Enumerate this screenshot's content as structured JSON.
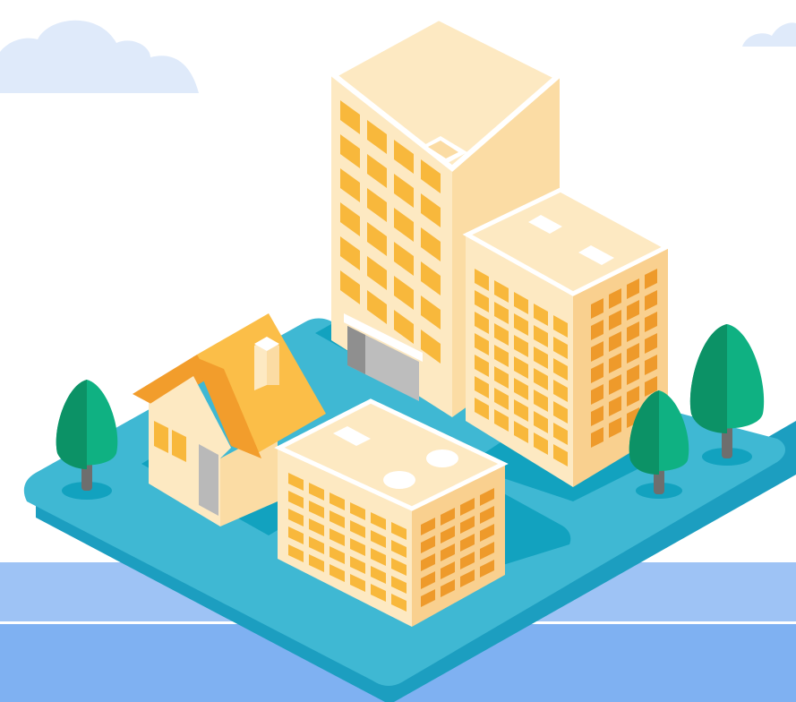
{
  "scene": {
    "palette": {
      "sky": "#ffffff",
      "cloud": "#dfeafa",
      "water_light": "#9ec3f5",
      "water_dark": "#7fb1f2",
      "water_line": "#ffffff",
      "island_top": "#3fb8d3",
      "island_side": "#1c9ec0",
      "footprint": "#12a2bf",
      "building_light": "#fde9c2",
      "building_mid": "#fbdca4",
      "building_dark": "#f9d08f",
      "roof_edge": "#ffffff",
      "window_light": "#f8b83c",
      "window_dark": "#ee9a2b",
      "house_roof": "#fbbe48",
      "house_roof_dark": "#f29d2c",
      "door": "#b9b9b9",
      "garage": "#bdbdbd",
      "garage_dark": "#8f8f8f",
      "tree_light": "#0fb182",
      "tree_dark": "#0c9266",
      "trunk": "#6e6e6e"
    },
    "icons": [
      "cloud-icon",
      "tree-icon",
      "house-icon",
      "office-tower-icon",
      "apartment-building-icon"
    ]
  }
}
